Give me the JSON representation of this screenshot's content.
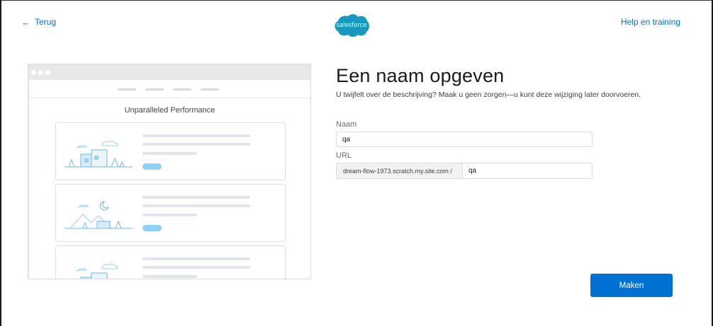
{
  "header": {
    "back_label": "Terug",
    "logo_text": "salesforce",
    "help_label": "Help en training"
  },
  "preview": {
    "heading": "Unparalleled Performance"
  },
  "form": {
    "title": "Een naam opgeven",
    "subtitle": "U twijfelt over de beschrijving? Maak u geen zorgen—u kunt deze wijziging later doorvoeren.",
    "name_label": "Naam",
    "name_value": "qa",
    "url_label": "URL",
    "url_prefix": "dream-flow-1973.scratch.my.site.com /",
    "url_value": "qa"
  },
  "actions": {
    "make_label": "Maken"
  },
  "colors": {
    "accent": "#0070d2",
    "logo": "#1798c1"
  }
}
